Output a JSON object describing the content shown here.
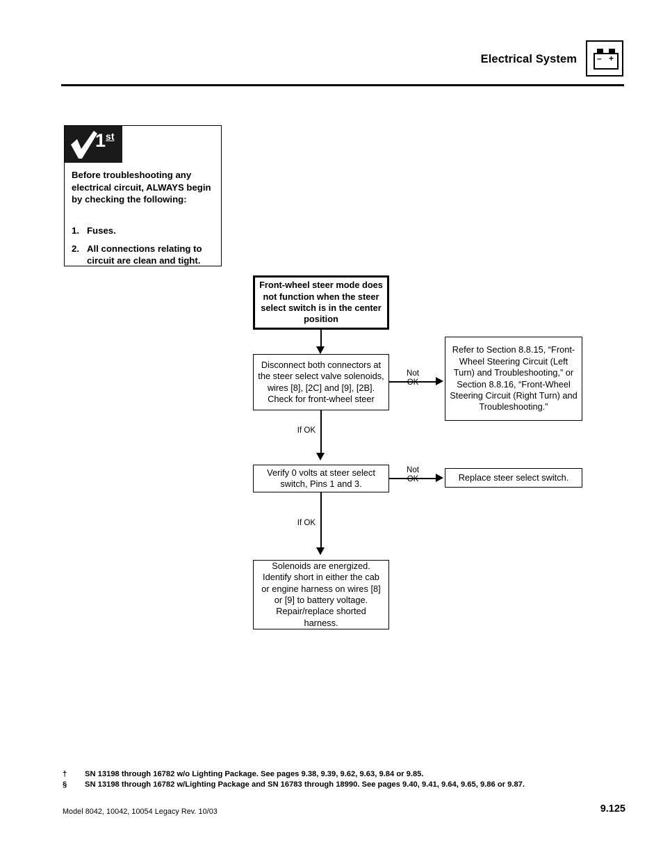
{
  "header": {
    "title": "Electrical System",
    "battery_icon": "battery-icon",
    "battery_minus": "–",
    "battery_plus": "+"
  },
  "check_first": {
    "badge_checkmark": "check-icon",
    "badge_ordinal_number": "1",
    "badge_ordinal_suffix": "st",
    "intro": "Before troubleshooting any electrical circuit, ALWAYS begin by checking the following:",
    "items": [
      {
        "num": "1.",
        "text": "Fuses."
      },
      {
        "num": "2.",
        "text": "All connections relating to circuit are clean and tight."
      }
    ]
  },
  "flowchart": {
    "start": "Front-wheel steer mode does not function when the steer select switch is in the center position",
    "disconnect": "Disconnect both connectors at the steer select valve solenoids, wires [8], [2C] and [9], [2B]. Check for front-wheel steer",
    "refer": "Refer to Section 8.8.15, “Front-Wheel Steering Circuit (Left Turn) and Troubleshooting,” or Section 8.8.16, “Front-Wheel Steering Circuit (Right Turn) and Troubleshooting.”",
    "verify": "Verify 0 volts at steer select switch, Pins 1 and 3.",
    "replace": "Replace steer select switch.",
    "solenoid": "Solenoids are energized. Identify short in either the cab or engine harness on wires [8] or [9] to battery voltage. Repair/replace shorted harness.",
    "label_not_ok_1": "Not\nOK",
    "label_not_ok_2": "Not\nOK",
    "label_if_ok_1": "If OK",
    "label_if_ok_2": "If OK"
  },
  "footnotes": [
    {
      "mark": "†",
      "text": "SN 13198 through 16782 w/o Lighting Package. See pages 9.38, 9.39, 9.62, 9.63, 9.84 or 9.85."
    },
    {
      "mark": "§",
      "text": "SN 13198 through 16782 w/Lighting Package and SN 16783 through 18990. See pages 9.40, 9.41, 9.64, 9.65, 9.86 or 9.87."
    }
  ],
  "footer": {
    "model_line": "Model  8042, 10042, 10054 Legacy    Rev.  10/03",
    "page_number": "9.125"
  }
}
